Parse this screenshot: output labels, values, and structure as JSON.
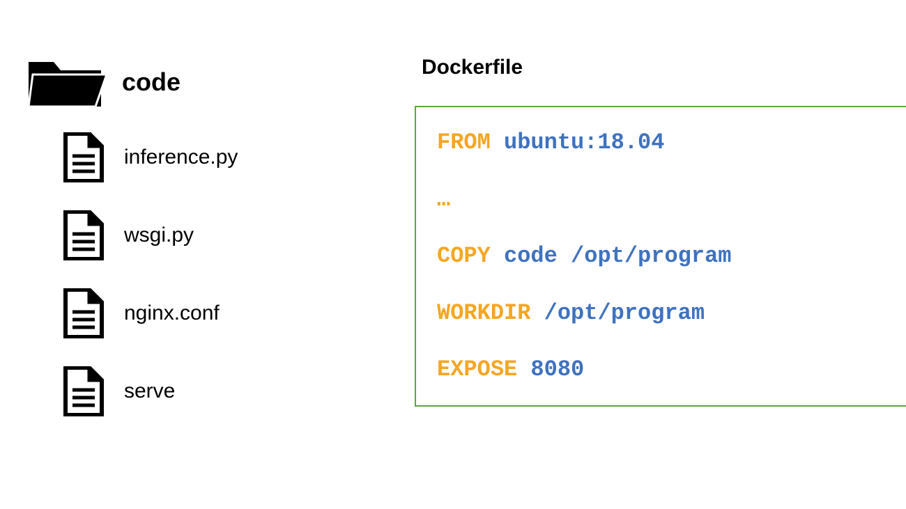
{
  "folder": {
    "name": "code",
    "files": [
      {
        "name": "inference.py"
      },
      {
        "name": "wsgi.py"
      },
      {
        "name": "nginx.conf"
      },
      {
        "name": "serve"
      }
    ]
  },
  "dockerfile": {
    "title": "Dockerfile",
    "lines": [
      {
        "keyword": "FROM",
        "args": "ubuntu:18.04"
      },
      {
        "ellipsis": "…"
      },
      {
        "keyword": "COPY",
        "args": "code /opt/program"
      },
      {
        "keyword": "WORKDIR",
        "args": "/opt/program"
      },
      {
        "keyword": "EXPOSE",
        "args": "8080"
      }
    ]
  }
}
